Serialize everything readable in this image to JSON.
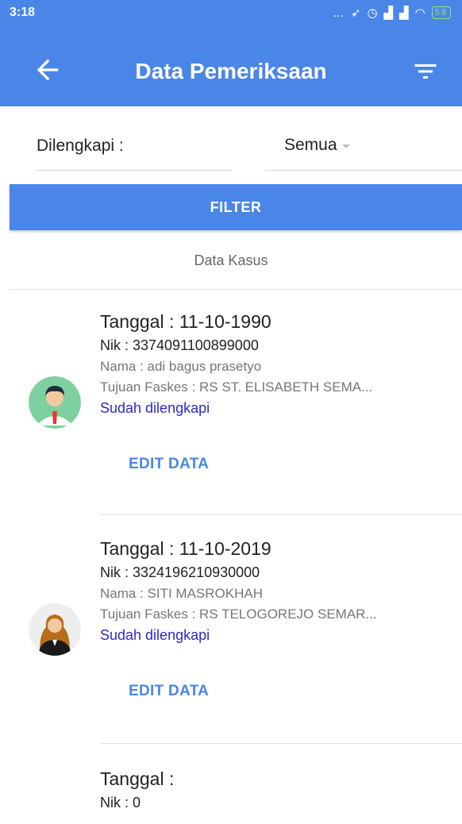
{
  "status_bar": {
    "time": "3:18",
    "icons": [
      "signal-dots-icon",
      "navigation-icon",
      "sync-icon",
      "alarm-icon",
      "cell-signal-icon",
      "cell-signal-icon",
      "wifi-icon",
      "battery-icon"
    ],
    "battery": "58"
  },
  "app_bar": {
    "title": "Data Pemeriksaan",
    "back_icon": "arrow-back-icon",
    "filter_icon": "filter-list-icon"
  },
  "filter_form": {
    "label": "Dilengkapi :",
    "dropdown_value": "Semua",
    "button_label": "FILTER"
  },
  "section": {
    "title": "Data Kasus"
  },
  "cases": [
    {
      "avatar": "male-avatar-icon",
      "tanggal": "Tanggal : 11-10-1990",
      "nik": "Nik : 3374091100899000",
      "nama": "Nama : adi bagus prasetyo",
      "tujuan": "Tujuan Faskes : RS ST. ELISABETH SEMA...",
      "status": "Sudah dilengkapi",
      "edit_label": "EDIT DATA"
    },
    {
      "avatar": "female-avatar-icon",
      "tanggal": "Tanggal : 11-10-2019",
      "nik": "Nik : 3324196210930000",
      "nama": "Nama : SITI MASROKHAH",
      "tujuan": "Tujuan Faskes : RS TELOGOREJO SEMAR...",
      "status": "Sudah dilengkapi",
      "edit_label": "EDIT DATA"
    },
    {
      "tanggal": "Tanggal :",
      "nik": "Nik : 0"
    }
  ],
  "colors": {
    "primary": "#4a86e8",
    "status_text": "#2c2cc7",
    "battery": "#9be36b"
  }
}
